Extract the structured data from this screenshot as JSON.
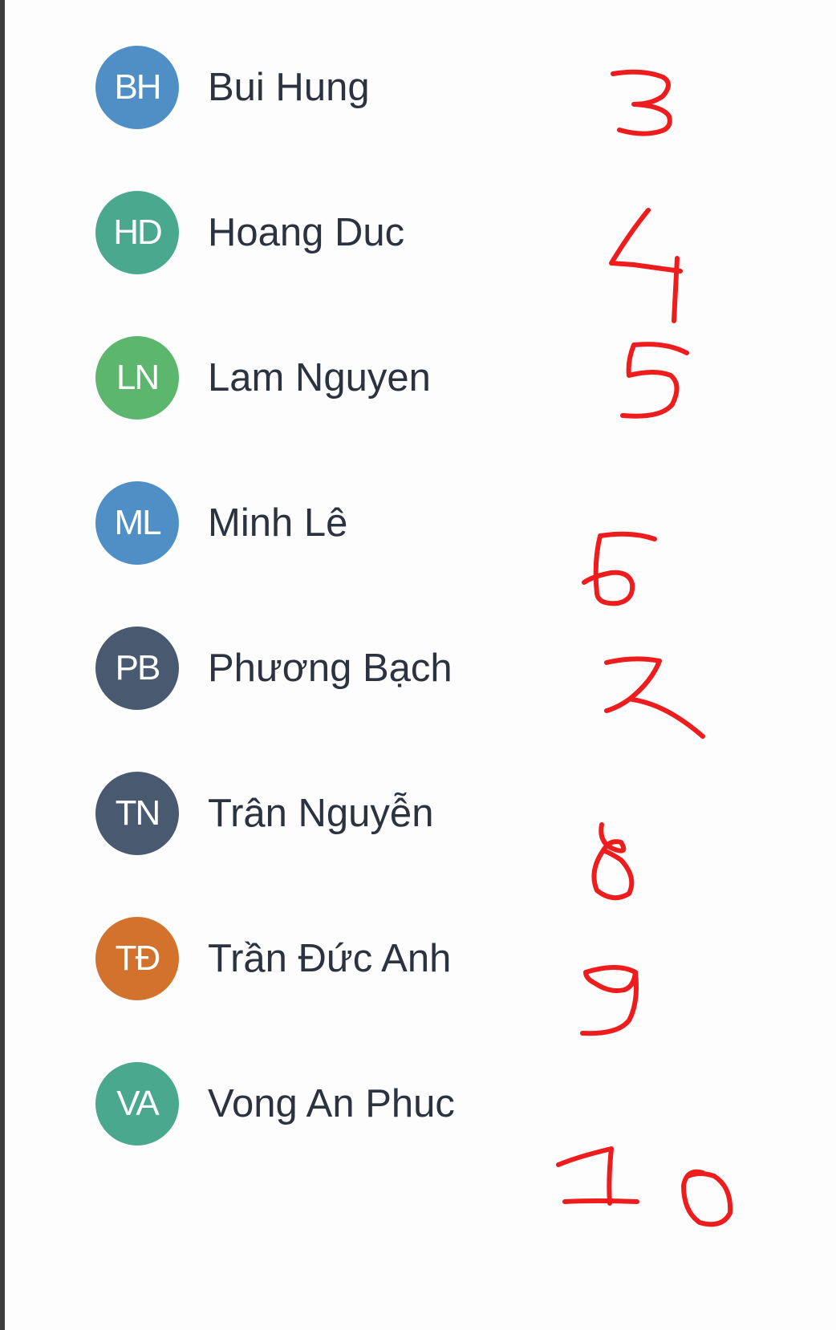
{
  "members": [
    {
      "initials": "BH",
      "name": "Bui Hung",
      "color": "#4f8fc6"
    },
    {
      "initials": "HD",
      "name": "Hoang Duc",
      "color": "#4aa88f"
    },
    {
      "initials": "LN",
      "name": "Lam Nguyen",
      "color": "#5cb66e"
    },
    {
      "initials": "ML",
      "name": "Minh Lê",
      "color": "#4f8fc6"
    },
    {
      "initials": "PB",
      "name": "Phương Bạch",
      "color": "#495a70"
    },
    {
      "initials": "TN",
      "name": "Trân Nguyễn",
      "color": "#495a70"
    },
    {
      "initials": "TĐ",
      "name": "Trần Đức Anh",
      "color": "#d2722c"
    },
    {
      "initials": "VA",
      "name": "Vong An Phuc",
      "color": "#4aa88f"
    }
  ],
  "handwritten_numbers": [
    "3",
    "4",
    "5",
    "6",
    "7",
    "8",
    "9",
    "10"
  ],
  "annotation_color": "#ee1c1c"
}
